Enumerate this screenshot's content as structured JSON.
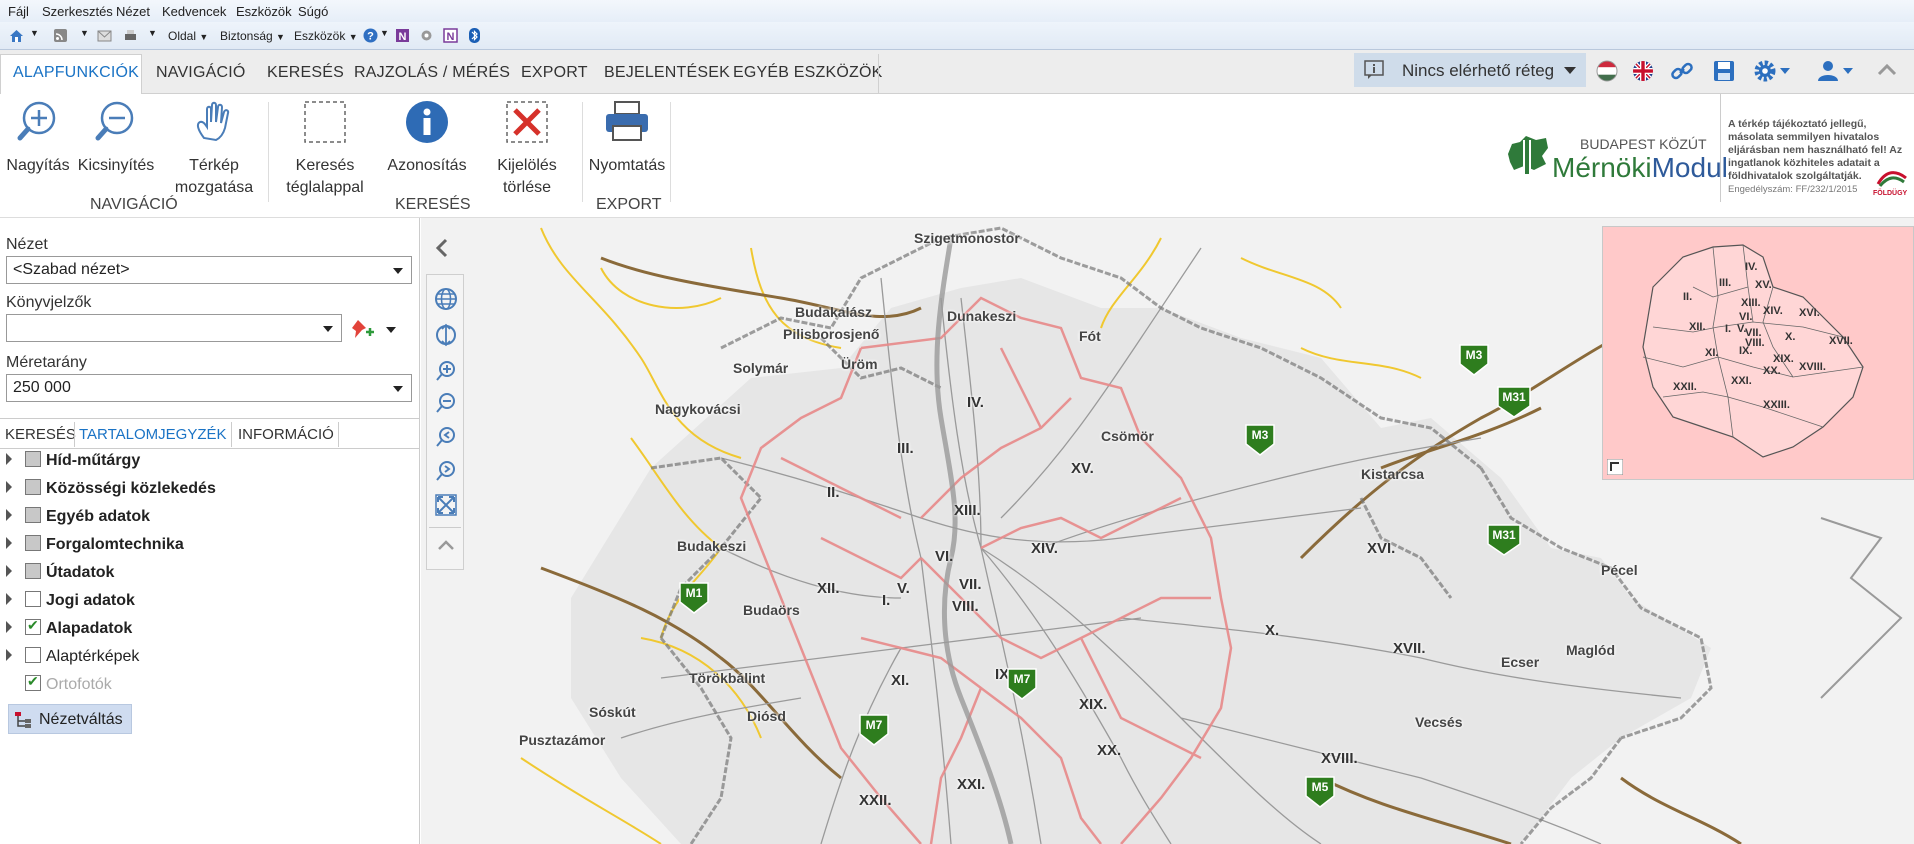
{
  "ie_menu": [
    "Fájl",
    "Szerkesztés",
    "Nézet",
    "Kedvencek",
    "Eszközök",
    "Súgó"
  ],
  "ie_cmd": {
    "page": "Oldal",
    "security": "Biztonság",
    "tools": "Eszközök"
  },
  "tabs": [
    "ALAPFUNKCIÓK",
    "NAVIGÁCIÓ",
    "KERESÉS",
    "RAJZOLÁS / MÉRÉS",
    "EXPORT",
    "BEJELENTÉSEK",
    "EGYÉB ESZKÖZÖK"
  ],
  "layer_select": "Nincs elérhető réteg",
  "ribbon": {
    "zoom_in": "Nagyítás",
    "zoom_out": "Kicsinyítés",
    "pan_1": "Térkép",
    "pan_2": "mozgatása",
    "rect_1": "Keresés",
    "rect_2": "téglalappal",
    "identify": "Azonosítás",
    "clear_1": "Kijelölés",
    "clear_2": "törlése",
    "print": "Nyomtatás",
    "group_nav": "NAVIGÁCIÓ",
    "group_search": "KERESÉS",
    "group_export": "EXPORT"
  },
  "brand": {
    "company": "BUDAPEST KÖZÚT",
    "product_a": "Mérnöki",
    "product_b": "Modul",
    "disclaimer_1": "A térkép tájékoztató jellegű,",
    "disclaimer_2": "másolata semmilyen hivatalos",
    "disclaimer_3": "eljárásban nem használható fel! Az",
    "disclaimer_4": "ingatlanok közhiteles adatait a",
    "disclaimer_5": "földhivatalok szolgáltatják.",
    "license": "Engedélyszám: FF/232/1/2015",
    "foldugy": "FÖLDÜGY"
  },
  "panel": {
    "view_label": "Nézet",
    "view_value": "<Szabad nézet>",
    "bookmarks_label": "Könyvjelzők",
    "scale_label": "Méretarány",
    "scale_value": "250 000",
    "tabs": [
      "KERESÉS",
      "TARTALOMJEGYZÉK",
      "INFORMÁCIÓ"
    ],
    "toc": [
      {
        "label": "Híd-műtárgy",
        "bold": true,
        "state": "part",
        "expand": true
      },
      {
        "label": "Közösségi közlekedés",
        "bold": true,
        "state": "part",
        "expand": true
      },
      {
        "label": "Egyéb adatok",
        "bold": true,
        "state": "part",
        "expand": true
      },
      {
        "label": "Forgalomtechnika",
        "bold": true,
        "state": "part",
        "expand": true
      },
      {
        "label": "Útadatok",
        "bold": true,
        "state": "part",
        "expand": true
      },
      {
        "label": "Jogi adatok",
        "bold": true,
        "state": "off",
        "expand": true
      },
      {
        "label": "Alapadatok",
        "bold": true,
        "state": "on",
        "expand": true
      },
      {
        "label": "Alaptérképek",
        "bold": false,
        "state": "off",
        "expand": true
      },
      {
        "label": "Ortofotók",
        "bold": false,
        "state": "on",
        "expand": false,
        "dim": true
      }
    ],
    "view_switch": "Nézetváltás"
  },
  "map_labels": [
    {
      "t": "Szigetmonostor"
    },
    {
      "t": "Budakalász"
    },
    {
      "t": "Dunakeszi"
    },
    {
      "t": "Fót"
    },
    {
      "t": "Pilisborosjenő"
    },
    {
      "t": "Üröm"
    },
    {
      "t": "Solymár"
    },
    {
      "t": "Nagykovácsi"
    },
    {
      "t": "Csömör"
    },
    {
      "t": "Kistarcsa"
    },
    {
      "t": "Budakeszi"
    },
    {
      "t": "Budaörs"
    },
    {
      "t": "Törökbálint"
    },
    {
      "t": "Diósd"
    },
    {
      "t": "Sóskút"
    },
    {
      "t": "Pusztazámor"
    },
    {
      "t": "Pécel"
    },
    {
      "t": "Maglód"
    },
    {
      "t": "Ecser"
    },
    {
      "t": "Vecsés"
    },
    {
      "t": "N"
    }
  ],
  "districts": [
    "IV.",
    "III.",
    "XV.",
    "II.",
    "XIII.",
    "XIV.",
    "XVI.",
    "VI.",
    "VII.",
    "I.",
    "V.",
    "XII.",
    "VIII.",
    "X.",
    "XVII.",
    "XI.",
    "IX.",
    "XIX.",
    "XX.",
    "XVIII.",
    "XXI.",
    "XXII."
  ],
  "shields": [
    "M3",
    "M31",
    "M3",
    "M31",
    "M1",
    "M7",
    "M7",
    "M5"
  ],
  "overview_labels": [
    "IV.",
    "XV.",
    "III.",
    "II.",
    "XIII.",
    "XIV.",
    "XVI.",
    "VI.",
    "I.",
    "V.",
    "VII.",
    "XII.",
    "VIII.",
    "X.",
    "XVII.",
    "XI.",
    "IX.",
    "XIX.",
    "XX.",
    "XVIII.",
    "XXI.",
    "XXII.",
    "XXIII."
  ]
}
